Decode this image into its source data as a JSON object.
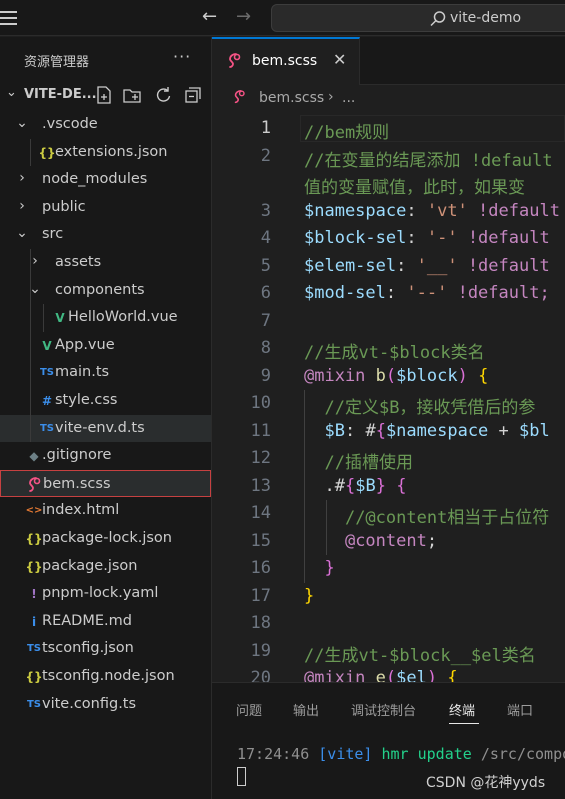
{
  "titlebar": {
    "search_text": "vite-demo"
  },
  "sidebar": {
    "title": "资源管理器",
    "more": "···",
    "workspace": "VITE-DE...",
    "items": [
      {
        "label": ".vscode",
        "kind": "folder-open",
        "depth": 1
      },
      {
        "label": "extensions.json",
        "kind": "json",
        "depth": 2
      },
      {
        "label": "node_modules",
        "kind": "folder",
        "depth": 1
      },
      {
        "label": "public",
        "kind": "folder",
        "depth": 1
      },
      {
        "label": "src",
        "kind": "folder-open",
        "depth": 1
      },
      {
        "label": "assets",
        "kind": "folder",
        "depth": 2
      },
      {
        "label": "components",
        "kind": "folder-open",
        "depth": 2
      },
      {
        "label": "HelloWorld.vue",
        "kind": "vue",
        "depth": 3
      },
      {
        "label": "App.vue",
        "kind": "vue",
        "depth": 2
      },
      {
        "label": "main.ts",
        "kind": "ts",
        "depth": 2
      },
      {
        "label": "style.css",
        "kind": "css",
        "depth": 2
      },
      {
        "label": "vite-env.d.ts",
        "kind": "ts",
        "depth": 2
      },
      {
        "label": ".gitignore",
        "kind": "git",
        "depth": 1
      },
      {
        "label": "bem.scss",
        "kind": "scss",
        "depth": 1
      },
      {
        "label": "index.html",
        "kind": "html",
        "depth": 1
      },
      {
        "label": "package-lock.json",
        "kind": "json",
        "depth": 1
      },
      {
        "label": "package.json",
        "kind": "json",
        "depth": 1
      },
      {
        "label": "pnpm-lock.yaml",
        "kind": "yaml",
        "depth": 1
      },
      {
        "label": "README.md",
        "kind": "info",
        "depth": 1
      },
      {
        "label": "tsconfig.json",
        "kind": "tsjson",
        "depth": 1
      },
      {
        "label": "tsconfig.node.json",
        "kind": "json",
        "depth": 1
      },
      {
        "label": "vite.config.ts",
        "kind": "ts",
        "depth": 1
      }
    ],
    "selected_index": 13,
    "hover_index": 11
  },
  "editor": {
    "tab_label": "bem.scss",
    "tab_close": "✕",
    "breadcrumb_file": "bem.scss",
    "breadcrumb_sep": "›",
    "breadcrumb_more": "...",
    "current_line": 1,
    "lines": [
      {
        "n": "1",
        "tokens": [
          [
            "comment",
            "//bem规则"
          ]
        ]
      },
      {
        "n": "2",
        "tokens": [
          [
            "comment",
            "//在变量的结尾添加 !default"
          ]
        ]
      },
      {
        "n": "",
        "tokens": [
          [
            "comment",
            "值的变量赋值，此时，如果变"
          ]
        ]
      },
      {
        "n": "3",
        "tokens": [
          [
            "var",
            "$namespace"
          ],
          [
            "punct",
            ": "
          ],
          [
            "str",
            "'vt'"
          ],
          [
            "punct",
            " "
          ],
          [
            "kw",
            "!default"
          ]
        ]
      },
      {
        "n": "4",
        "tokens": [
          [
            "var",
            "$block-sel"
          ],
          [
            "punct",
            ": "
          ],
          [
            "str",
            "'-'"
          ],
          [
            "punct",
            " "
          ],
          [
            "kw",
            "!default"
          ]
        ]
      },
      {
        "n": "5",
        "tokens": [
          [
            "var",
            "$elem-sel"
          ],
          [
            "punct",
            ": "
          ],
          [
            "str",
            "'__'"
          ],
          [
            "punct",
            " "
          ],
          [
            "kw",
            "!default"
          ]
        ]
      },
      {
        "n": "6",
        "tokens": [
          [
            "var",
            "$mod-sel"
          ],
          [
            "punct",
            ": "
          ],
          [
            "str",
            "'--'"
          ],
          [
            "punct",
            " "
          ],
          [
            "kw",
            "!default;"
          ]
        ]
      },
      {
        "n": "7",
        "tokens": []
      },
      {
        "n": "8",
        "tokens": [
          [
            "comment",
            "//生成vt-$block类名"
          ]
        ]
      },
      {
        "n": "9",
        "tokens": [
          [
            "kw",
            "@mixin"
          ],
          [
            "punct",
            " "
          ],
          [
            "fn",
            "b"
          ],
          [
            "brace2",
            "("
          ],
          [
            "var",
            "$block"
          ],
          [
            "brace2",
            ")"
          ],
          [
            "punct",
            " "
          ],
          [
            "brace1",
            "{"
          ]
        ]
      },
      {
        "n": "10",
        "tokens": [
          [
            "punct",
            "  "
          ],
          [
            "comment",
            "//定义$B，接收凭借后的参"
          ]
        ]
      },
      {
        "n": "11",
        "tokens": [
          [
            "punct",
            "  "
          ],
          [
            "var",
            "$B"
          ],
          [
            "punct",
            ": #"
          ],
          [
            "brace2",
            "{"
          ],
          [
            "var",
            "$namespace"
          ],
          [
            "punct",
            " + "
          ],
          [
            "var",
            "$bl"
          ]
        ]
      },
      {
        "n": "12",
        "tokens": [
          [
            "punct",
            "  "
          ],
          [
            "comment",
            "//插槽使用"
          ]
        ]
      },
      {
        "n": "13",
        "tokens": [
          [
            "punct",
            "  "
          ],
          [
            "white",
            ".#"
          ],
          [
            "brace2",
            "{"
          ],
          [
            "var",
            "$B"
          ],
          [
            "brace2",
            "}"
          ],
          [
            "punct",
            " "
          ],
          [
            "brace2",
            "{"
          ]
        ]
      },
      {
        "n": "14",
        "tokens": [
          [
            "punct",
            "    "
          ],
          [
            "comment",
            "//@content相当于占位符"
          ]
        ]
      },
      {
        "n": "15",
        "tokens": [
          [
            "punct",
            "    "
          ],
          [
            "kw",
            "@content"
          ],
          [
            "punct",
            ";"
          ]
        ]
      },
      {
        "n": "16",
        "tokens": [
          [
            "punct",
            "  "
          ],
          [
            "brace2",
            "}"
          ]
        ]
      },
      {
        "n": "17",
        "tokens": [
          [
            "brace1",
            "}"
          ]
        ]
      },
      {
        "n": "18",
        "tokens": []
      },
      {
        "n": "19",
        "tokens": [
          [
            "comment",
            "//生成vt-$block__$el类名"
          ]
        ]
      },
      {
        "n": "20",
        "tokens": [
          [
            "kw",
            "@mixin"
          ],
          [
            "punct",
            " "
          ],
          [
            "fn",
            "e"
          ],
          [
            "brace2",
            "("
          ],
          [
            "var",
            "$el"
          ],
          [
            "brace2",
            ")"
          ],
          [
            "punct",
            " "
          ],
          [
            "brace1",
            "{"
          ]
        ]
      }
    ]
  },
  "panel": {
    "tabs": [
      "问题",
      "输出",
      "调试控制台",
      "终端",
      "端口"
    ],
    "active_tab": 3,
    "terminal": {
      "time": "17:24:46",
      "tag": "[vite]",
      "action": "hmr update",
      "path": "/src/compo"
    },
    "watermark": "CSDN @花神yyds"
  },
  "colors": {
    "accent": "#0078d4",
    "selection_border": "#c64141",
    "scss_icon": "#f55385",
    "vue_icon": "#41b883",
    "ts_icon": "#3b8eea",
    "json_icon": "#cbcb41"
  }
}
